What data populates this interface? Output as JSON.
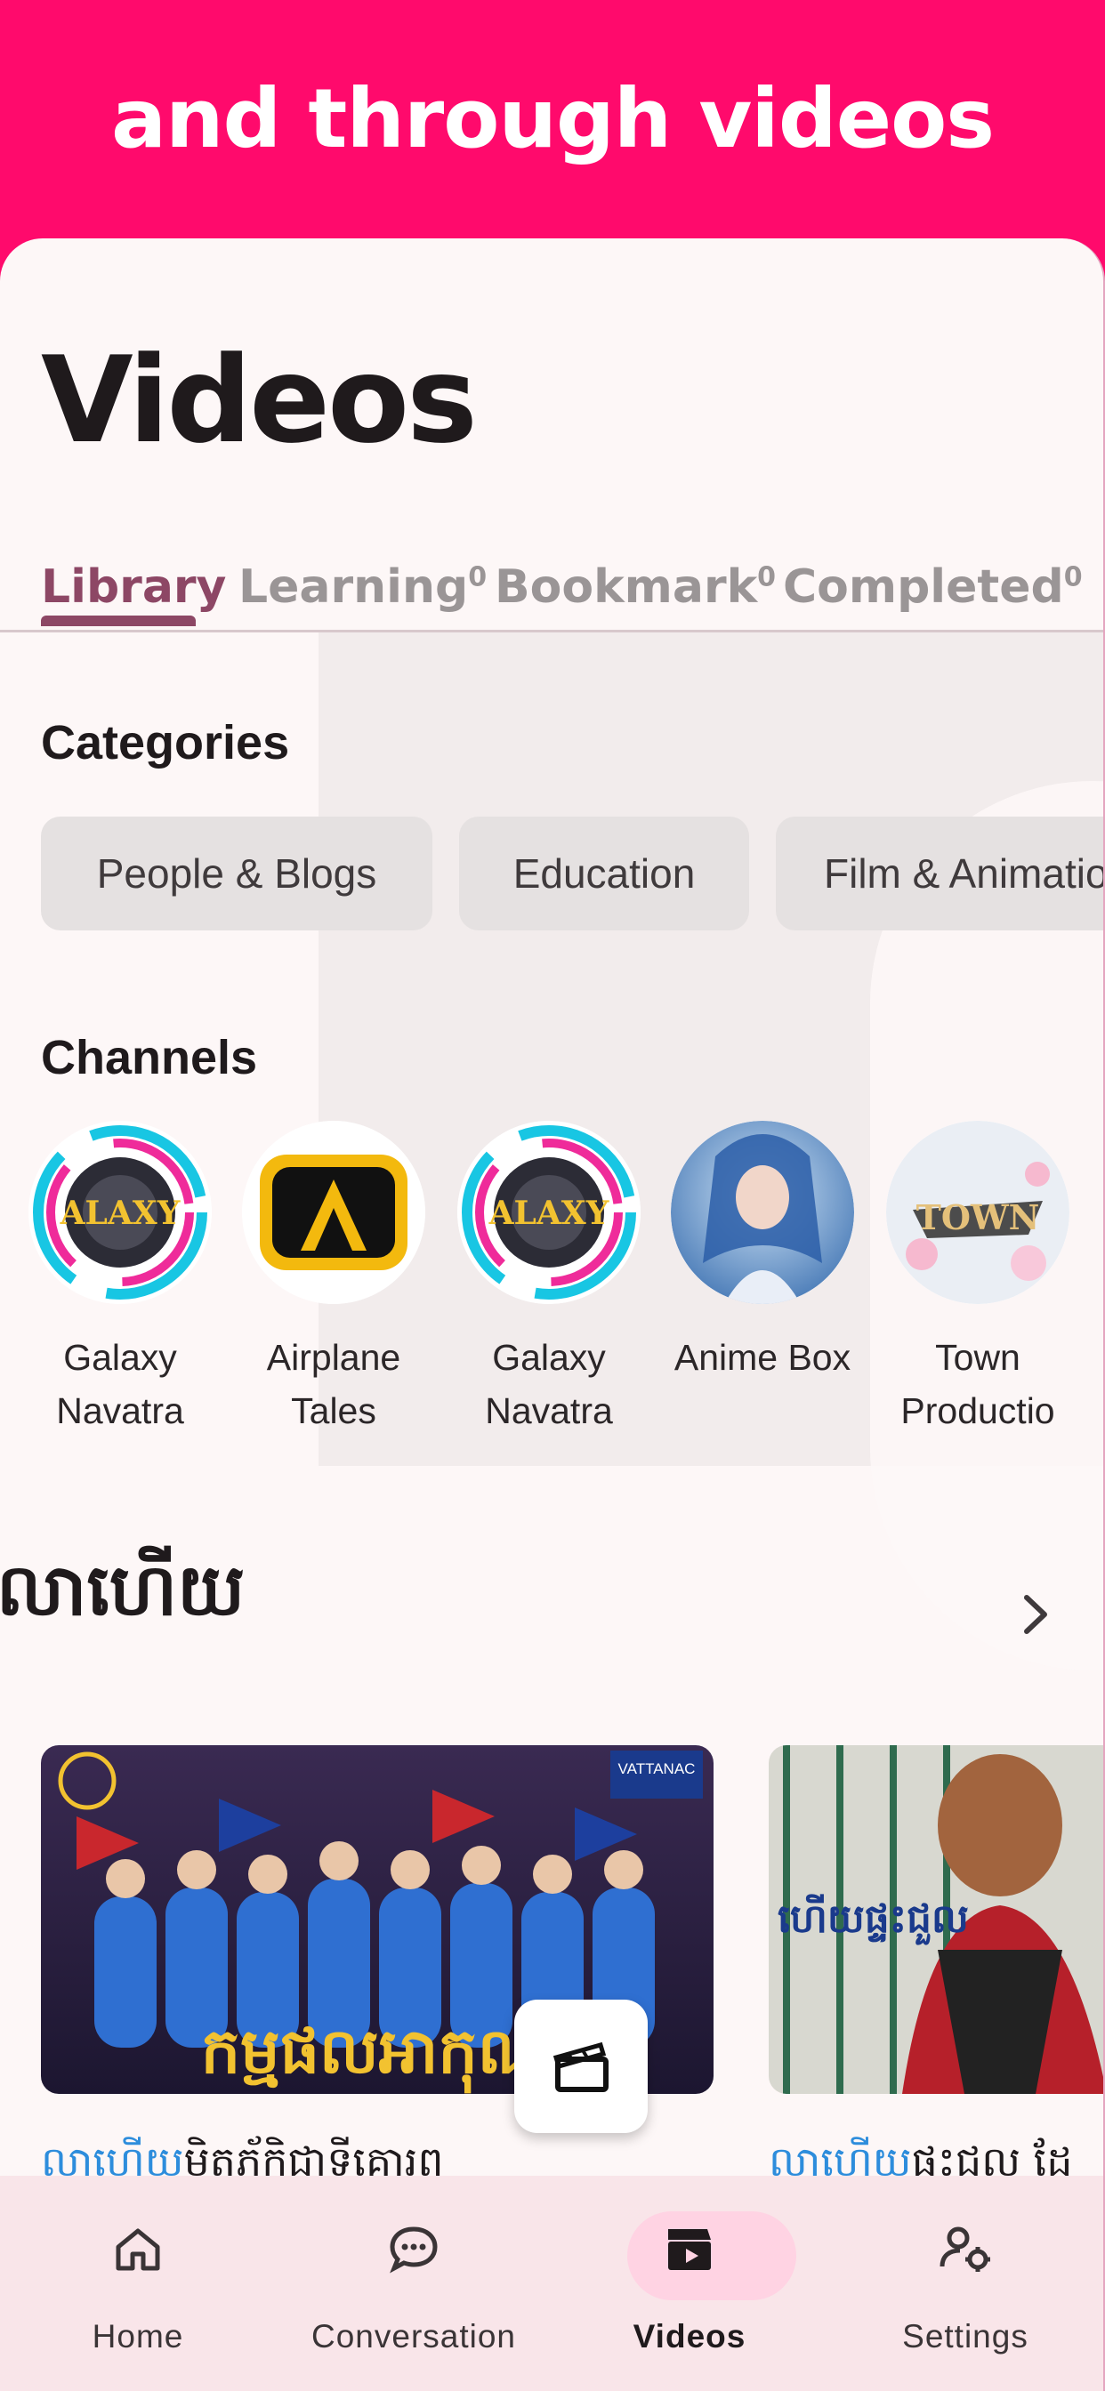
{
  "banner": {
    "text": "and through videos"
  },
  "page": {
    "title": "Videos"
  },
  "tabs": [
    {
      "label": "Library",
      "count": ""
    },
    {
      "label": "Learning",
      "count": "0"
    },
    {
      "label": "Bookmark",
      "count": "0"
    },
    {
      "label": "Completed",
      "count": "0"
    }
  ],
  "categories": {
    "title": "Categories",
    "items": [
      "People & Blogs",
      "Education",
      "Film & Animation"
    ]
  },
  "channels": {
    "title": "Channels",
    "items": [
      {
        "name": "Galaxy\nNavatra"
      },
      {
        "name": "Airplane\nTales"
      },
      {
        "name": "Galaxy\nNavatra"
      },
      {
        "name": "Anime Box"
      },
      {
        "name": "Town\nProductio"
      }
    ]
  },
  "playlist": {
    "title": "លាហើយ"
  },
  "videos": [
    {
      "caption_highlight": "លាហើយ",
      "caption_rest": "មិតភ័កិជាទីគោរព",
      "thumb_title": "កម្មផលអាកុណ",
      "thumb_badge": "VATTANAC"
    },
    {
      "caption_highlight": "លាហើយ",
      "caption_rest": "ផះជល ដែ",
      "thumb_title": "ហើយផ្ទះជួល",
      "thumb_badge": ""
    }
  ],
  "bottom_nav": [
    {
      "label": "Home",
      "icon": "home-icon"
    },
    {
      "label": "Conversation",
      "icon": "chat-bubble-icon"
    },
    {
      "label": "Videos",
      "icon": "clapperboard-icon"
    },
    {
      "label": "Settings",
      "icon": "user-settings-icon"
    }
  ],
  "colors": {
    "accent": "#ff0a6c",
    "tab_active": "#8d4765",
    "link": "#2d8ddc",
    "nav_bg": "#f9e5e9"
  }
}
